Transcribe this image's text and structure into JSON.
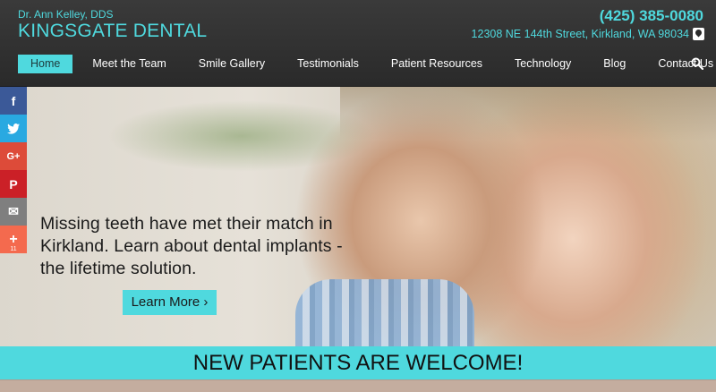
{
  "header": {
    "doctor": "Dr. Ann Kelley, DDS",
    "practice": "KINGSGATE DENTAL",
    "phone": "(425) 385-0080",
    "address": "12308 NE 144th Street, Kirkland, WA 98034"
  },
  "nav": {
    "items": [
      {
        "label": "Home",
        "active": true
      },
      {
        "label": "Meet the Team"
      },
      {
        "label": "Smile Gallery"
      },
      {
        "label": "Testimonials"
      },
      {
        "label": "Patient Resources"
      },
      {
        "label": "Technology"
      },
      {
        "label": "Blog"
      },
      {
        "label": "Contact Us"
      }
    ]
  },
  "hero": {
    "headline": "Missing teeth have met their match in Kirkland. Learn about dental implants - the lifetime solution.",
    "button_label": "Learn More ›"
  },
  "share": {
    "items": [
      {
        "icon": "facebook-icon",
        "glyph": "f",
        "color": "#3b5998"
      },
      {
        "icon": "twitter-icon",
        "glyph": "🐦",
        "color": "#29a9e1"
      },
      {
        "icon": "google-plus-icon",
        "glyph": "G+",
        "color": "#dd4b39"
      },
      {
        "icon": "pinterest-icon",
        "glyph": "P",
        "color": "#cb2027"
      },
      {
        "icon": "email-icon",
        "glyph": "✉",
        "color": "#7f7f7f"
      },
      {
        "icon": "more-share-icon",
        "glyph": "+",
        "color": "#f46a4e",
        "count": "11"
      }
    ]
  },
  "banner": {
    "text": "NEW PATIENTS ARE WELCOME!"
  },
  "colors": {
    "accent": "#4fd9de",
    "header_bg": "#2b2b2b"
  }
}
